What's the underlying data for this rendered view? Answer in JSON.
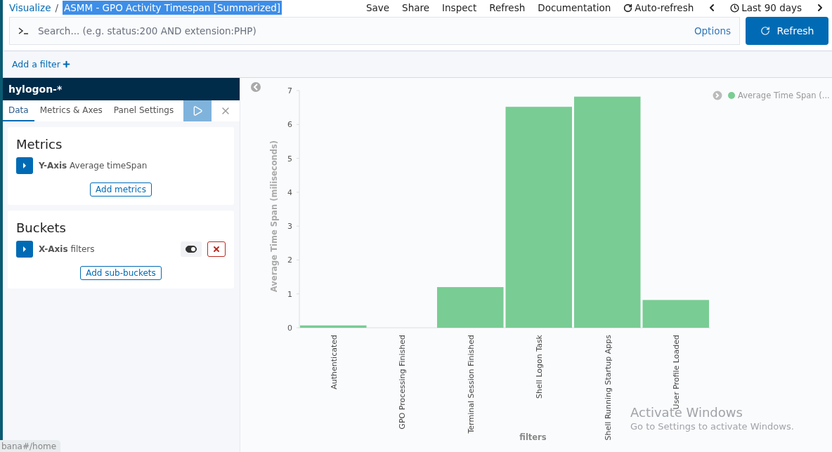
{
  "breadcrumb": {
    "root": "Visualize",
    "separator": "/",
    "title": "ASMM - GPO Activity Timespan [Summarized]"
  },
  "top_menu": [
    {
      "kind": "text",
      "label": "Save"
    },
    {
      "kind": "text",
      "label": "Share"
    },
    {
      "kind": "text",
      "label": "Inspect"
    },
    {
      "kind": "text",
      "label": "Refresh"
    },
    {
      "kind": "text",
      "label": "Documentation"
    },
    {
      "kind": "refresh",
      "label": "Auto-refresh"
    },
    {
      "kind": "prev"
    },
    {
      "kind": "clock",
      "label": "Last 90 days"
    },
    {
      "kind": "next"
    }
  ],
  "query": {
    "placeholder": "Search... (e.g. status:200 AND extension:PHP)",
    "options": "Options",
    "refresh_button": "Refresh"
  },
  "filter_bar": {
    "add_filter": "Add a filter"
  },
  "sidebar": {
    "index_pattern": "hylogon-*",
    "tabs": [
      {
        "label": "Data",
        "selected": true
      },
      {
        "label": "Metrics & Axes",
        "selected": false
      },
      {
        "label": "Panel Settings",
        "selected": false
      }
    ],
    "sections": [
      {
        "title": "Metrics",
        "rows": [
          {
            "kind": "plain",
            "axis": "Y-Axis",
            "description": "Average timeSpan"
          }
        ],
        "add_button": "Add metrics"
      },
      {
        "title": "Buckets",
        "rows": [
          {
            "kind": "removable",
            "axis": "X-Axis",
            "description": "filters",
            "enabled": true
          }
        ],
        "add_button": "Add sub-buckets"
      }
    ]
  },
  "chart": {
    "legend": "Average Time Span (...",
    "chart_data": {
      "type": "bar",
      "xlabel": "filters",
      "ylabel": "Average Time Span (miliseconds)",
      "categories": [
        "Authenticated",
        "GPO Processing Finished",
        "Terminal Session Finished",
        "Shell Logon Task",
        "Shell Running Startup Apps",
        "User Profile Loaded"
      ],
      "series": [
        {
          "color": "#79cc94",
          "values": [
            0.07,
            0,
            1.2,
            6.52,
            6.82,
            0.82
          ]
        }
      ],
      "ylim": [
        0,
        7
      ],
      "yticks": [
        0,
        1,
        2,
        3,
        4,
        5,
        6,
        7
      ]
    }
  },
  "status_url": "bana#/home",
  "os_notice": {
    "title": "Activate Windows",
    "subtitle": "Go to Settings to activate Windows."
  }
}
